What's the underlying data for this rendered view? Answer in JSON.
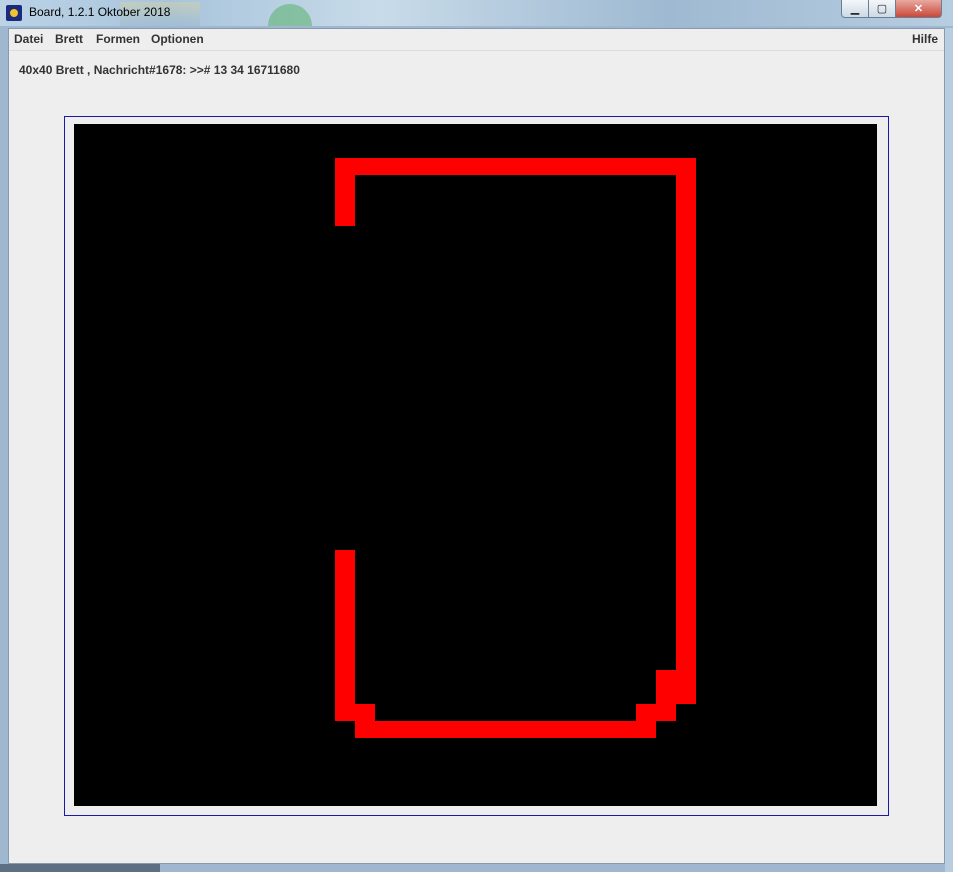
{
  "window": {
    "title": "Board, 1.2.1 Oktober 2018",
    "controls": {
      "minimize": "▁",
      "maximize": "▢",
      "close": "✕"
    }
  },
  "menu": {
    "left": [
      "Datei",
      "Brett",
      "Formen",
      "Optionen"
    ],
    "right": "Hilfe"
  },
  "status": {
    "text": "40x40 Brett , Nachricht#1678: >># 13 34 16711680"
  },
  "board": {
    "grid_size": 40,
    "background_color": "#000000",
    "cell_color": "#ff0000",
    "lit_cells": [
      [
        13,
        2
      ],
      [
        14,
        2
      ],
      [
        15,
        2
      ],
      [
        16,
        2
      ],
      [
        17,
        2
      ],
      [
        18,
        2
      ],
      [
        19,
        2
      ],
      [
        20,
        2
      ],
      [
        21,
        2
      ],
      [
        22,
        2
      ],
      [
        23,
        2
      ],
      [
        24,
        2
      ],
      [
        25,
        2
      ],
      [
        26,
        2
      ],
      [
        27,
        2
      ],
      [
        28,
        2
      ],
      [
        29,
        2
      ],
      [
        30,
        2
      ],
      [
        13,
        3
      ],
      [
        30,
        3
      ],
      [
        13,
        4
      ],
      [
        30,
        4
      ],
      [
        13,
        5
      ],
      [
        30,
        5
      ],
      [
        30,
        6
      ],
      [
        30,
        7
      ],
      [
        30,
        8
      ],
      [
        30,
        9
      ],
      [
        30,
        10
      ],
      [
        30,
        11
      ],
      [
        30,
        12
      ],
      [
        30,
        13
      ],
      [
        30,
        14
      ],
      [
        30,
        15
      ],
      [
        30,
        16
      ],
      [
        30,
        17
      ],
      [
        30,
        18
      ],
      [
        30,
        19
      ],
      [
        30,
        20
      ],
      [
        30,
        21
      ],
      [
        30,
        22
      ],
      [
        30,
        23
      ],
      [
        30,
        24
      ],
      [
        30,
        25
      ],
      [
        30,
        26
      ],
      [
        30,
        27
      ],
      [
        30,
        28
      ],
      [
        30,
        29
      ],
      [
        30,
        30
      ],
      [
        30,
        31
      ],
      [
        30,
        32
      ],
      [
        30,
        33
      ],
      [
        13,
        25
      ],
      [
        13,
        26
      ],
      [
        13,
        27
      ],
      [
        13,
        28
      ],
      [
        13,
        29
      ],
      [
        13,
        30
      ],
      [
        13,
        31
      ],
      [
        13,
        32
      ],
      [
        13,
        33
      ],
      [
        29,
        32
      ],
      [
        29,
        33
      ],
      [
        13,
        34
      ],
      [
        14,
        34
      ],
      [
        28,
        34
      ],
      [
        29,
        34
      ],
      [
        14,
        35
      ],
      [
        15,
        35
      ],
      [
        16,
        35
      ],
      [
        17,
        35
      ],
      [
        18,
        35
      ],
      [
        19,
        35
      ],
      [
        20,
        35
      ],
      [
        21,
        35
      ],
      [
        22,
        35
      ],
      [
        23,
        35
      ],
      [
        24,
        35
      ],
      [
        25,
        35
      ],
      [
        26,
        35
      ],
      [
        27,
        35
      ],
      [
        28,
        35
      ]
    ]
  }
}
